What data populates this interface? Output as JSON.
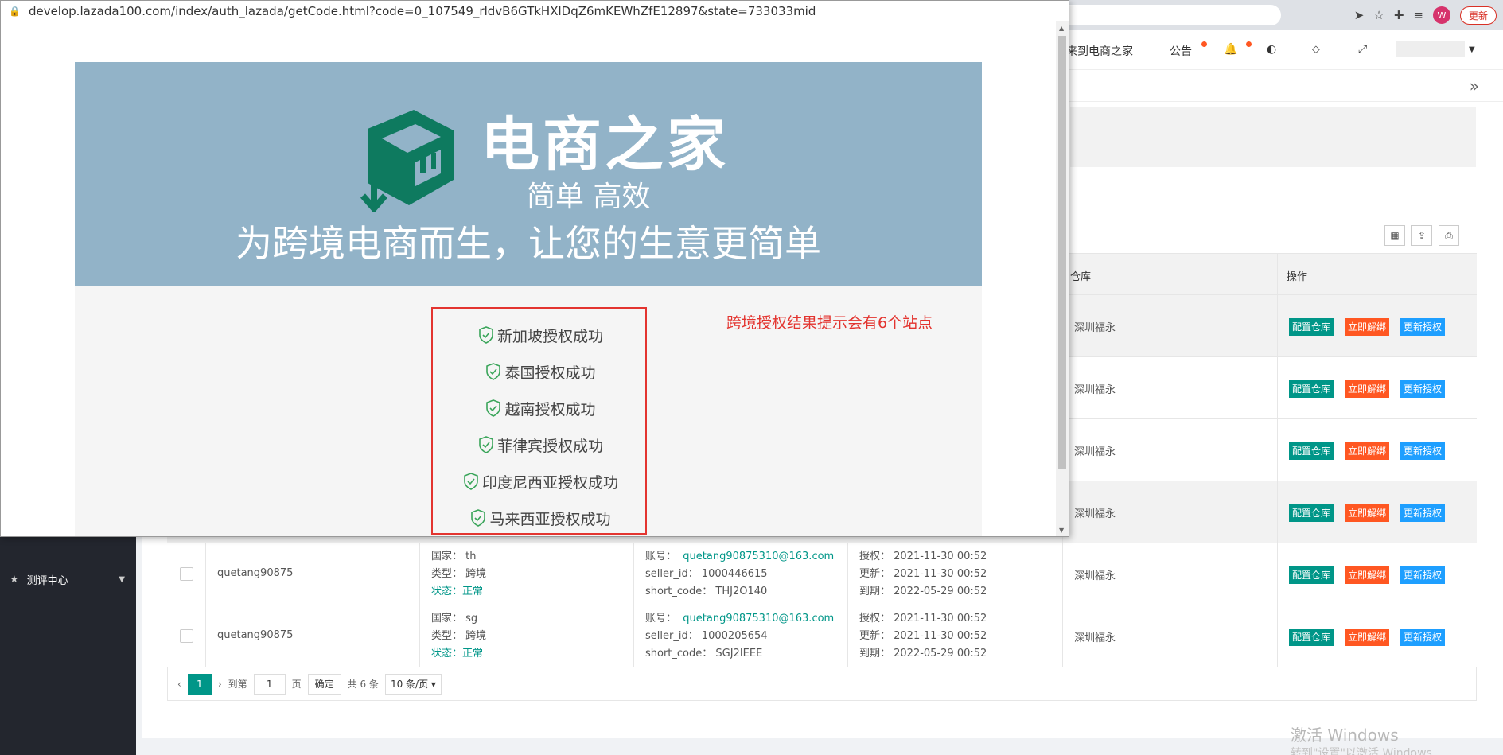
{
  "browser": {
    "url": "develop.lazada100.com/index/auth_lazada/getCode.html?code=0_107549_rldvB6GTkHXlDqZ6mKEWhZfE12897&state=733033mid",
    "avatar_letter": "W",
    "update_label": "更新"
  },
  "header": {
    "welcome": "来到电商之家",
    "announcement": "公告"
  },
  "sidebar": {
    "item_label": "测评中心"
  },
  "table": {
    "columns": {
      "warehouse": "仓库",
      "action": "操作"
    },
    "buttons": {
      "config": "配置仓库",
      "unbind": "立即解绑",
      "reauth": "更新授权"
    },
    "upper_rows": [
      {
        "warehouse": "深圳福永"
      },
      {
        "warehouse": "深圳福永"
      },
      {
        "warehouse": "深圳福永"
      },
      {
        "warehouse": "深圳福永"
      }
    ],
    "rows": [
      {
        "name": "quetang90875",
        "country": "国家：  th",
        "type": "类型：  跨境",
        "status_label": "状态：",
        "status": "正常",
        "account_label": "账号：",
        "account": "quetang90875310@163.com",
        "seller_id": "seller_id：  1000446615",
        "short_code": "short_code：  THJ2O140",
        "auth": "授权：  2021-11-30 00:52",
        "updated": "更新：  2021-11-30 00:52",
        "expire": "到期：  2022-05-29 00:52",
        "warehouse": "深圳福永"
      },
      {
        "name": "quetang90875",
        "country": "国家：  sg",
        "type": "类型：  跨境",
        "status_label": "状态：",
        "status": "正常",
        "account_label": "账号：",
        "account": "quetang90875310@163.com",
        "seller_id": "seller_id：  1000205654",
        "short_code": "short_code：  SGJ2IEEE",
        "auth": "授权：  2021-11-30 00:52",
        "updated": "更新：  2021-11-30 00:52",
        "expire": "到期：  2022-05-29 00:52",
        "warehouse": "深圳福永"
      }
    ]
  },
  "pager": {
    "current": "1",
    "goto_label": "到第",
    "goto_value": "1",
    "page_label": "页",
    "confirm": "确定",
    "total": "共 6 条",
    "page_size": "10 条/页"
  },
  "watermark": {
    "line1": "激活 Windows",
    "line2": "转到\"设置\"以激活 Windows"
  },
  "popup": {
    "brand": "电商之家",
    "tagline_short": "简单  高效",
    "tagline_long": "为跨境电商而生，让您的生意更简单",
    "results": [
      "新加坡授权成功",
      "泰国授权成功",
      "越南授权成功",
      "菲律宾授权成功",
      "印度尼西亚授权成功",
      "马来西亚授权成功"
    ],
    "note": "跨境授权结果提示会有6个站点",
    "colors": {
      "banner": "#92b3c8",
      "logo": "#0e7a5f",
      "highlight": "#e3342f"
    }
  }
}
